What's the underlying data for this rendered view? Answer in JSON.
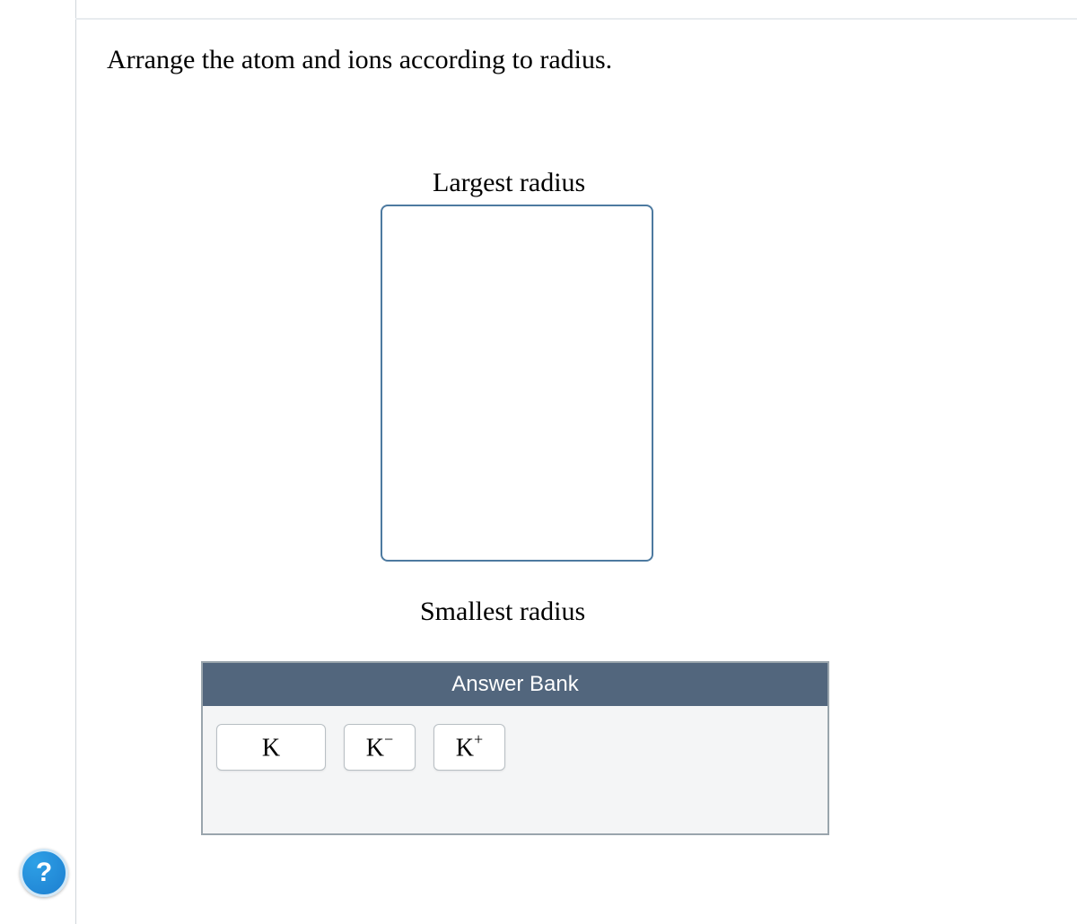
{
  "question": "Arrange the atom and ions according to radius.",
  "labels": {
    "top": "Largest radius",
    "bottom": "Smallest radius"
  },
  "bank": {
    "header": "Answer Bank",
    "tiles": [
      {
        "base": "K",
        "charge": ""
      },
      {
        "base": "K",
        "charge": "−"
      },
      {
        "base": "K",
        "charge": "+"
      }
    ]
  },
  "help": "?"
}
